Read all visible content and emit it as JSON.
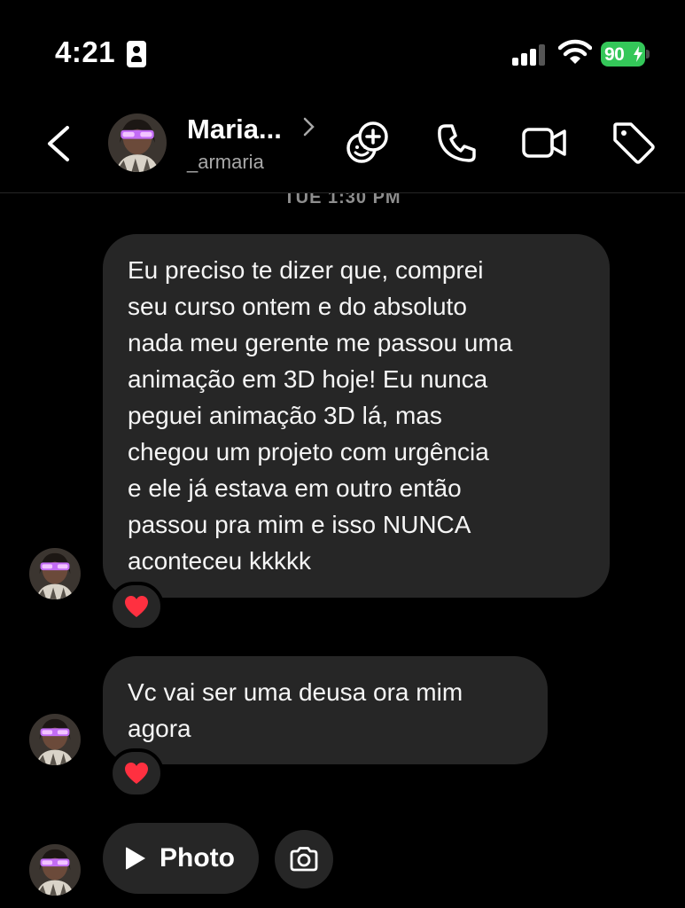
{
  "status_bar": {
    "time": "4:21",
    "battery_percent": "90"
  },
  "header": {
    "name": "Maria...",
    "username": "_armaria"
  },
  "conversation": {
    "timestamp_cut": "TUE 1:30 PM",
    "messages": [
      {
        "text": "Eu preciso te dizer que, comprei\nseu curso ontem e do absoluto\nnada meu gerente me passou uma\nanimação em 3D hoje! Eu nunca\npeguei animação 3D lá, mas\nchegou um projeto com urgência\ne ele já estava em outro então\npassou pra mim e isso NUNCA\naconteceu kkkkk",
        "reaction": "red-heart"
      },
      {
        "text": "Vc vai ser uma deusa ora mim\nagora",
        "reaction": "red-heart"
      }
    ],
    "attachment": {
      "label": "Photo"
    }
  },
  "colors": {
    "background": "#000000",
    "bubble": "#262626",
    "secondary_text": "#a8a8a8",
    "battery": "#34c759",
    "heart": "#ff3040"
  }
}
